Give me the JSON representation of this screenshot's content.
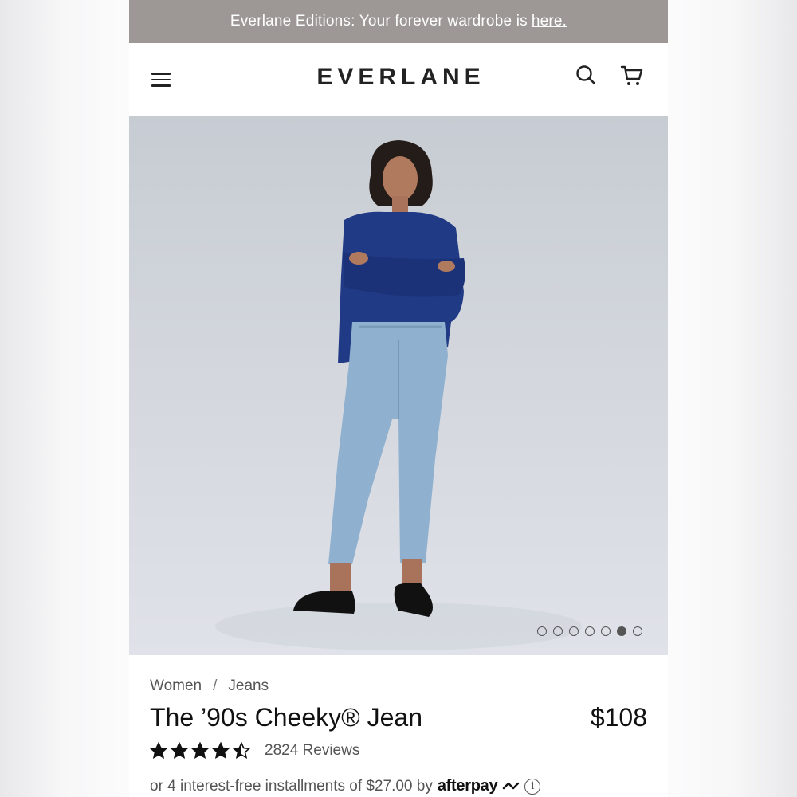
{
  "banner": {
    "text": "Everlane Editions: Your forever wardrobe is",
    "link_text": "here."
  },
  "header": {
    "logo": "EVERLANE",
    "menu_icon": "hamburger-menu-icon",
    "search_icon": "search-icon",
    "cart_icon": "cart-icon"
  },
  "carousel": {
    "image_alt": "Model wearing blue sweater and The '90s Cheeky Jean",
    "total_slides": 7,
    "active_slide": 6
  },
  "product": {
    "breadcrumb": [
      "Women",
      "Jeans"
    ],
    "breadcrumb_separator": "/",
    "title": "The ’90s Cheeky® Jean",
    "price": "$108",
    "rating": 4.5,
    "rating_max": 5,
    "reviews_text": "2824 Reviews",
    "afterpay_text": "or 4 interest-free installments of $27.00 by",
    "afterpay_brand": "afterpay",
    "info_icon_glyph": "i"
  },
  "colors": {
    "banner_bg": "#9d9896",
    "text_dark": "#111111",
    "text_muted": "#555555",
    "hero_bg": "#d3d7dd"
  }
}
